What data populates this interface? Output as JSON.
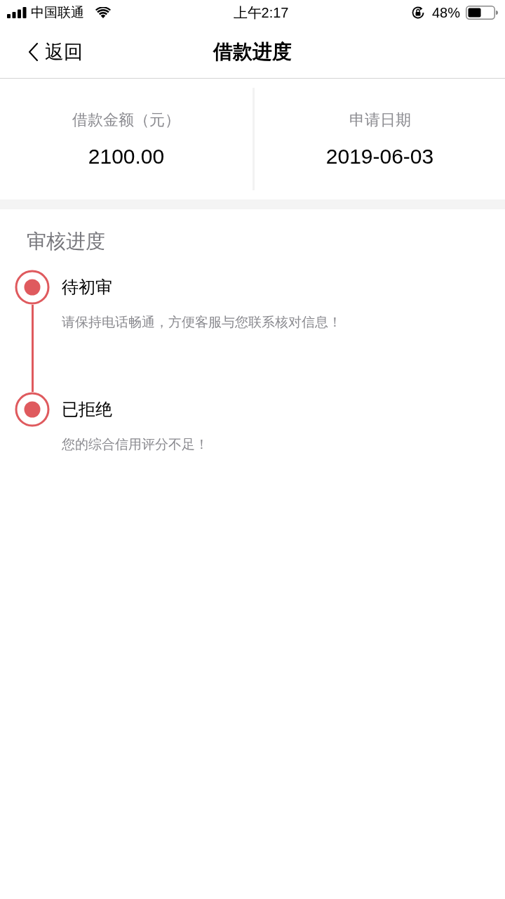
{
  "status_bar": {
    "carrier": "中国联通",
    "time": "上午2:17",
    "battery": "48%"
  },
  "nav": {
    "back": "返回",
    "title": "借款进度"
  },
  "summary": [
    {
      "label": "借款金额（元）",
      "value": "2100.00"
    },
    {
      "label": "申请日期",
      "value": "2019-06-03"
    }
  ],
  "progress": {
    "title": "审核进度",
    "steps": [
      {
        "title": "待初审",
        "description": "请保持电话畅通，方便客服与您联系核对信息！"
      },
      {
        "title": "已拒绝",
        "description": "您的综合信用评分不足！"
      }
    ]
  }
}
